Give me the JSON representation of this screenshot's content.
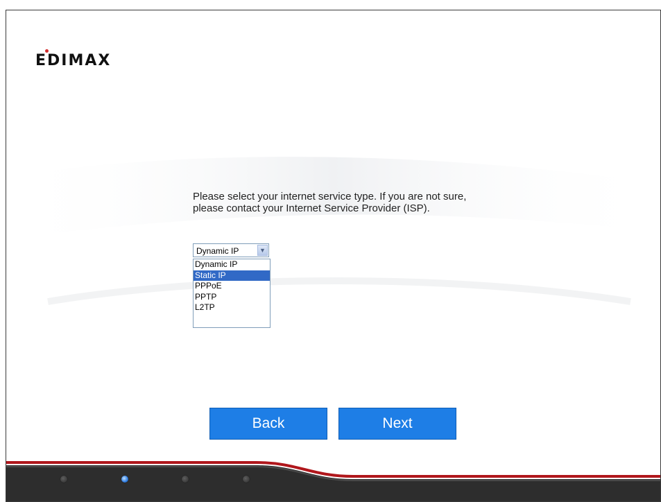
{
  "brand": {
    "logo_text": "EDIMAX"
  },
  "instruction": "Please select your internet service type. If you are not sure, please contact your Internet Service Provider (ISP).",
  "service_type_select": {
    "selected_value": "Dynamic IP",
    "highlighted_option": "Static IP",
    "options": [
      "Dynamic IP",
      "Static IP",
      "PPPoE",
      "PPTP",
      "L2TP"
    ]
  },
  "buttons": {
    "back_label": "Back",
    "next_label": "Next"
  },
  "progress": {
    "total_steps": 4,
    "current_step": 2
  },
  "colors": {
    "button_blue": "#1e7ee6",
    "footer_dark": "#2a2a2a",
    "footer_red": "#b0171c",
    "highlight": "#3169c6"
  }
}
